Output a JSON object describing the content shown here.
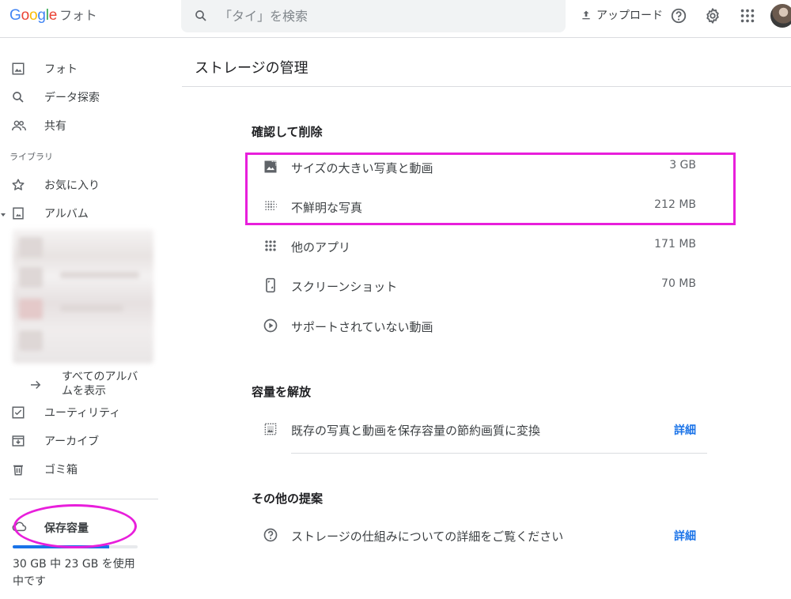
{
  "header": {
    "logo_letters": [
      "G",
      "o",
      "o",
      "g",
      "l",
      "e"
    ],
    "product": "フォト",
    "search_placeholder": "「タイ」を検索",
    "upload_label": "アップロード"
  },
  "sidebar": {
    "items_top": [
      {
        "label": "フォト",
        "icon": "photo-icon"
      },
      {
        "label": "データ探索",
        "icon": "search-icon"
      },
      {
        "label": "共有",
        "icon": "people-icon"
      }
    ],
    "library_label": "ライブラリ",
    "items_library": [
      {
        "label": "お気に入り",
        "icon": "star-icon"
      },
      {
        "label": "アルバム",
        "icon": "album-icon"
      }
    ],
    "show_all_albums": "すべてのアルバムを表示",
    "items_bottom": [
      {
        "label": "ユーティリティ",
        "icon": "utilities-icon"
      },
      {
        "label": "アーカイブ",
        "icon": "archive-icon"
      },
      {
        "label": "ゴミ箱",
        "icon": "trash-icon"
      }
    ],
    "storage": {
      "label": "保存容量",
      "usage_text": "30 GB 中 23 GB を使用中です",
      "used_fraction": 0.77
    }
  },
  "main": {
    "title": "ストレージの管理",
    "review_section": {
      "heading": "確認して削除",
      "rows": [
        {
          "label": "サイズの大きい写真と動画",
          "size": "3 GB",
          "icon": "large-photo-icon"
        },
        {
          "label": "不鮮明な写真",
          "size": "212 MB",
          "icon": "blurry-photo-icon"
        },
        {
          "label": "他のアプリ",
          "size": "171 MB",
          "icon": "apps-grid-icon"
        },
        {
          "label": "スクリーンショット",
          "size": "70 MB",
          "icon": "screenshot-icon"
        },
        {
          "label": "サポートされていない動画",
          "size": "",
          "icon": "play-circle-icon"
        }
      ]
    },
    "free_section": {
      "heading": "容量を解放",
      "row": {
        "label": "既存の写真と動画を保存容量の節約画質に変換",
        "link": "詳細",
        "icon": "compress-photo-icon"
      }
    },
    "other_section": {
      "heading": "その他の提案",
      "row": {
        "label": "ストレージの仕組みについての詳細をご覧ください",
        "link": "詳細",
        "icon": "help-icon"
      }
    }
  },
  "colors": {
    "accent": "#1a73e8",
    "annotation": "#e81fdb"
  }
}
